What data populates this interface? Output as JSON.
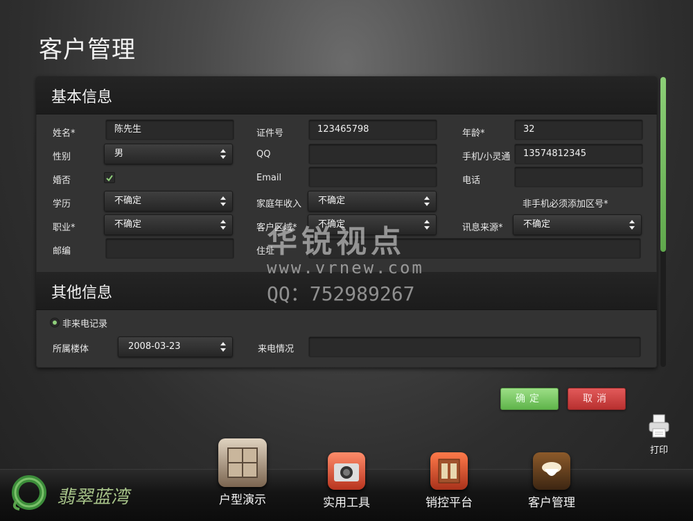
{
  "page": {
    "title": "客户管理"
  },
  "basic": {
    "heading": "基本信息",
    "name_label": "姓名*",
    "name_value": "陈先生",
    "id_label": "证件号",
    "id_value": "123465798",
    "age_label": "年龄*",
    "age_value": "32",
    "gender_label": "性别",
    "gender_value": "男",
    "qq_label": "QQ",
    "qq_value": "",
    "mobile_label": "手机/小灵通",
    "mobile_value": "13574812345",
    "married_label": "婚否",
    "married_checked": true,
    "email_label": "Email",
    "email_value": "",
    "phone_label": "电话",
    "phone_value": "",
    "edu_label": "学历",
    "edu_value": "不确定",
    "income_label": "家庭年收入",
    "income_value": "不确定",
    "phone_note": "非手机必须添加区号*",
    "job_label": "职业*",
    "job_value": "不确定",
    "region_label": "客户区域*",
    "region_value": "不确定",
    "source_label": "讯息来源*",
    "source_value": "不确定",
    "zip_label": "邮编",
    "zip_value": "",
    "address_label": "住址",
    "address_value": ""
  },
  "other": {
    "heading": "其他信息",
    "record_label": "非来电记录",
    "building_label": "所属楼体",
    "building_value": "2008-03-23",
    "call_label": "来电情况",
    "call_value": ""
  },
  "actions": {
    "ok": "确定",
    "cancel": "取消",
    "print": "打印"
  },
  "brand": {
    "logo_text": "翡翠蓝湾"
  },
  "nav": [
    {
      "label": "户型演示",
      "icon": "house-layout-icon"
    },
    {
      "label": "实用工具",
      "icon": "camera-icon"
    },
    {
      "label": "销控平台",
      "icon": "sales-control-icon"
    },
    {
      "label": "客户管理",
      "icon": "customer-icon"
    }
  ],
  "watermark": {
    "line1": "华锐视点",
    "line2": "www.vrnew.com",
    "line3": "QQ：752989267"
  },
  "colors": {
    "ok": "#6bbd55",
    "cancel": "#cc3b3b",
    "scroll": "#7cc466"
  }
}
